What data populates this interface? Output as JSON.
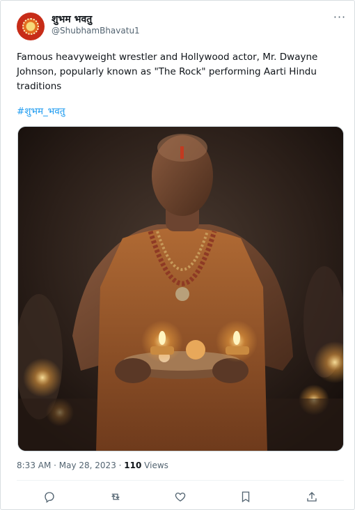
{
  "tweet": {
    "display_name": "शुभम भवतु",
    "handle": "@ShubhamBhavatu1",
    "text": "Famous heavyweight wrestler and Hollywood actor, Mr. Dwayne Johnson, popularly known as \"The Rock\" performing Aarti Hindu traditions",
    "hashtag": "#शुभम_भवतु",
    "time": "8:33 AM · May 28, 2023 · ",
    "views_count": "110",
    "views_label": " Views",
    "more_label": "···"
  },
  "actions": [
    {
      "name": "reply-icon"
    },
    {
      "name": "retweet-icon"
    },
    {
      "name": "like-icon"
    },
    {
      "name": "bookmark-icon"
    },
    {
      "name": "share-icon"
    }
  ],
  "colors": {
    "link": "#1d9bf0",
    "secondary_text": "#536471",
    "primary_text": "#0f1419"
  }
}
